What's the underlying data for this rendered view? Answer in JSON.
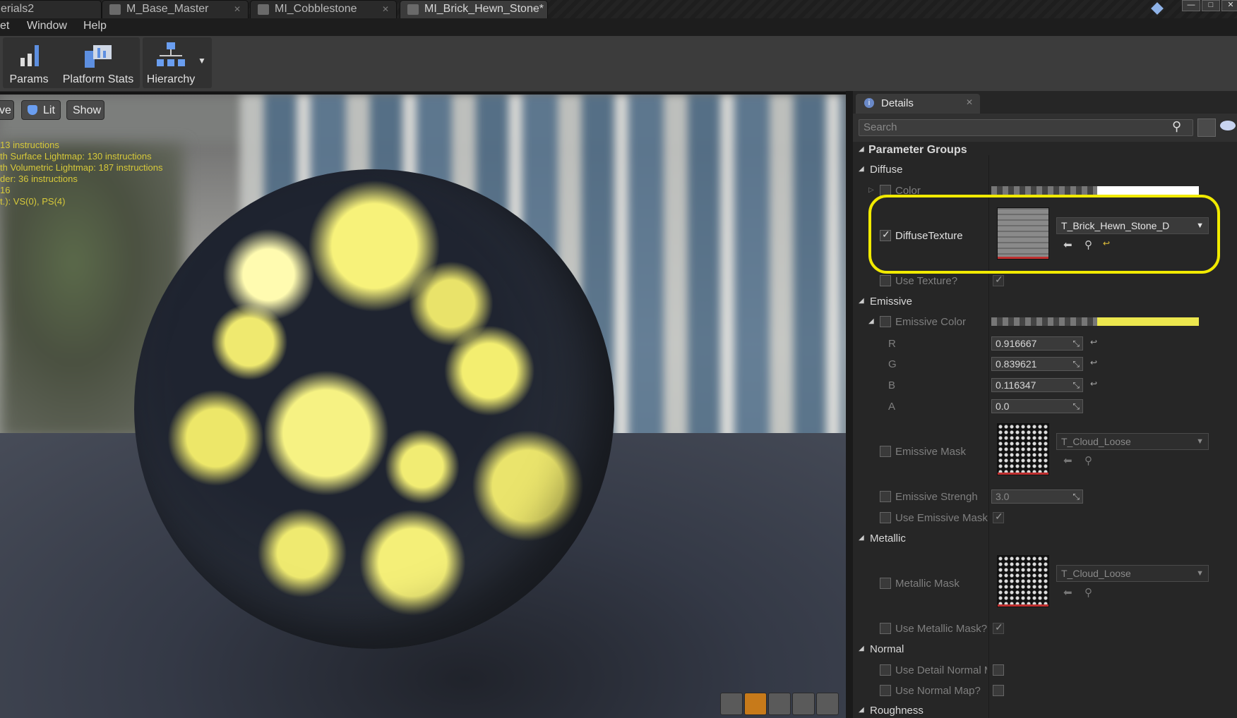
{
  "tabs": [
    {
      "label": "erials2"
    },
    {
      "label": "M_Base_Master"
    },
    {
      "label": "MI_Cobblestone"
    },
    {
      "label": "MI_Brick_Hewn_Stone*",
      "active": true
    }
  ],
  "menu": [
    "et",
    "Window",
    "Help"
  ],
  "toolbar": {
    "params": "Params",
    "platform_stats": "Platform Stats",
    "hierarchy": "Hierarchy"
  },
  "viewport": {
    "buttons": {
      "mode": "ve",
      "lit": "Lit",
      "show": "Show"
    },
    "stats": [
      "13 instructions",
      "th Surface Lightmap: 130 instructions",
      "th Volumetric Lightmap: 187 instructions",
      "der: 36 instructions",
      "16",
      "t.): VS(0), PS(4)"
    ]
  },
  "details": {
    "tab_label": "Details",
    "search_placeholder": "Search",
    "parameter_groups": "Parameter Groups",
    "diffuse": {
      "title": "Diffuse",
      "color_label": "Color",
      "diffuse_texture_label": "DiffuseTexture",
      "diffuse_texture_value": "T_Brick_Hewn_Stone_D",
      "use_texture_label": "Use Texture?"
    },
    "emissive": {
      "title": "Emissive",
      "emissive_color_label": "Emissive Color",
      "r_label": "R",
      "r_value": "0.916667",
      "g_label": "G",
      "g_value": "0.839621",
      "b_label": "B",
      "b_value": "0.116347",
      "a_label": "A",
      "a_value": "0.0",
      "emissive_mask_label": "Emissive Mask",
      "emissive_mask_value": "T_Cloud_Loose",
      "emissive_strength_label": "Emissive Strengh",
      "emissive_strength_value": "3.0",
      "use_emissive_mask_label": "Use Emissive Mask"
    },
    "metallic": {
      "title": "Metallic",
      "metallic_mask_label": "Metallic Mask",
      "metallic_mask_value": "T_Cloud_Loose",
      "use_metallic_mask_label": "Use Metallic Mask?"
    },
    "normal": {
      "title": "Normal",
      "use_detail_normal_label": "Use Detail Normal M",
      "use_normal_map_label": "Use Normal Map?"
    },
    "roughness": {
      "title": "Roughness"
    }
  },
  "colors": {
    "emissive": "#ece74e",
    "highlight": "#f1ea00"
  }
}
